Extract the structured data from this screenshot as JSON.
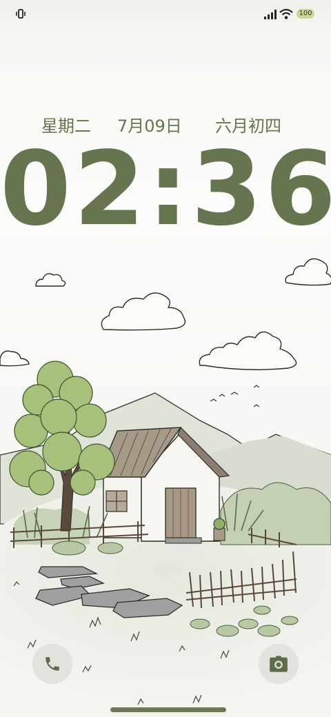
{
  "status_bar": {
    "icons": [
      "vibrate-icon",
      "signal-icon",
      "wifi-icon"
    ],
    "battery": "100",
    "battery_color": "#c8d79a"
  },
  "lockscreen": {
    "weekday": "星期二",
    "date": "7月09日",
    "lunar_date": "六月初四",
    "time": "02:36",
    "accent_color": "#66744f"
  },
  "shortcuts": {
    "left_icon": "phone-icon",
    "right_icon": "camera-icon"
  }
}
